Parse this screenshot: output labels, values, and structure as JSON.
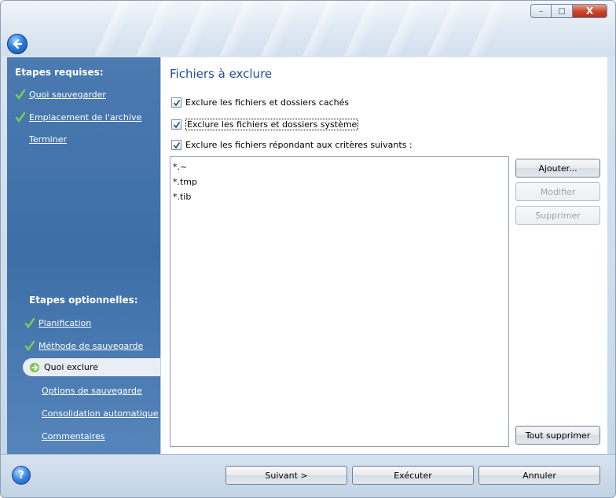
{
  "window": {
    "controls": {
      "minimize": "–",
      "maximize": "□",
      "close": "X"
    }
  },
  "sidebar": {
    "required_heading": "Etapes requises:",
    "required_items": [
      {
        "label": "Quoi sauvegarder",
        "done": true
      },
      {
        "label": "Emplacement de l'archive",
        "done": true
      },
      {
        "label": "Terminer",
        "done": false
      }
    ],
    "optional_heading": "Etapes optionnelles:",
    "optional_items": [
      {
        "label": "Planification",
        "done": true
      },
      {
        "label": "Méthode de sauvegarde",
        "done": true
      },
      {
        "label": "Quoi exclure",
        "current": true
      },
      {
        "label": "Options de sauvegarde"
      },
      {
        "label": "Consolidation automatique"
      },
      {
        "label": "Commentaires"
      }
    ]
  },
  "main": {
    "title": "Fichiers à exclure",
    "checkboxes": [
      {
        "label": "Exclure les fichiers et dossiers cachés",
        "checked": true
      },
      {
        "label": "Exclure les fichiers et dossiers système",
        "checked": true
      },
      {
        "label": "Exclure les fichiers répondant aux critères suivants :",
        "checked": true
      }
    ],
    "exclusions": [
      "*.~",
      "*.tmp",
      "*.tib"
    ],
    "buttons": {
      "add": "Ajouter...",
      "modify": "Modifier",
      "delete": "Supprimer",
      "delete_all": "Tout supprimer"
    }
  },
  "footer": {
    "help": "?",
    "next": "Suivant >",
    "execute": "Exécuter",
    "cancel": "Annuler"
  },
  "colors": {
    "sidebar": "#3d6ea6",
    "title_text": "#1e4f94",
    "check_green": "#6fbf3a"
  }
}
